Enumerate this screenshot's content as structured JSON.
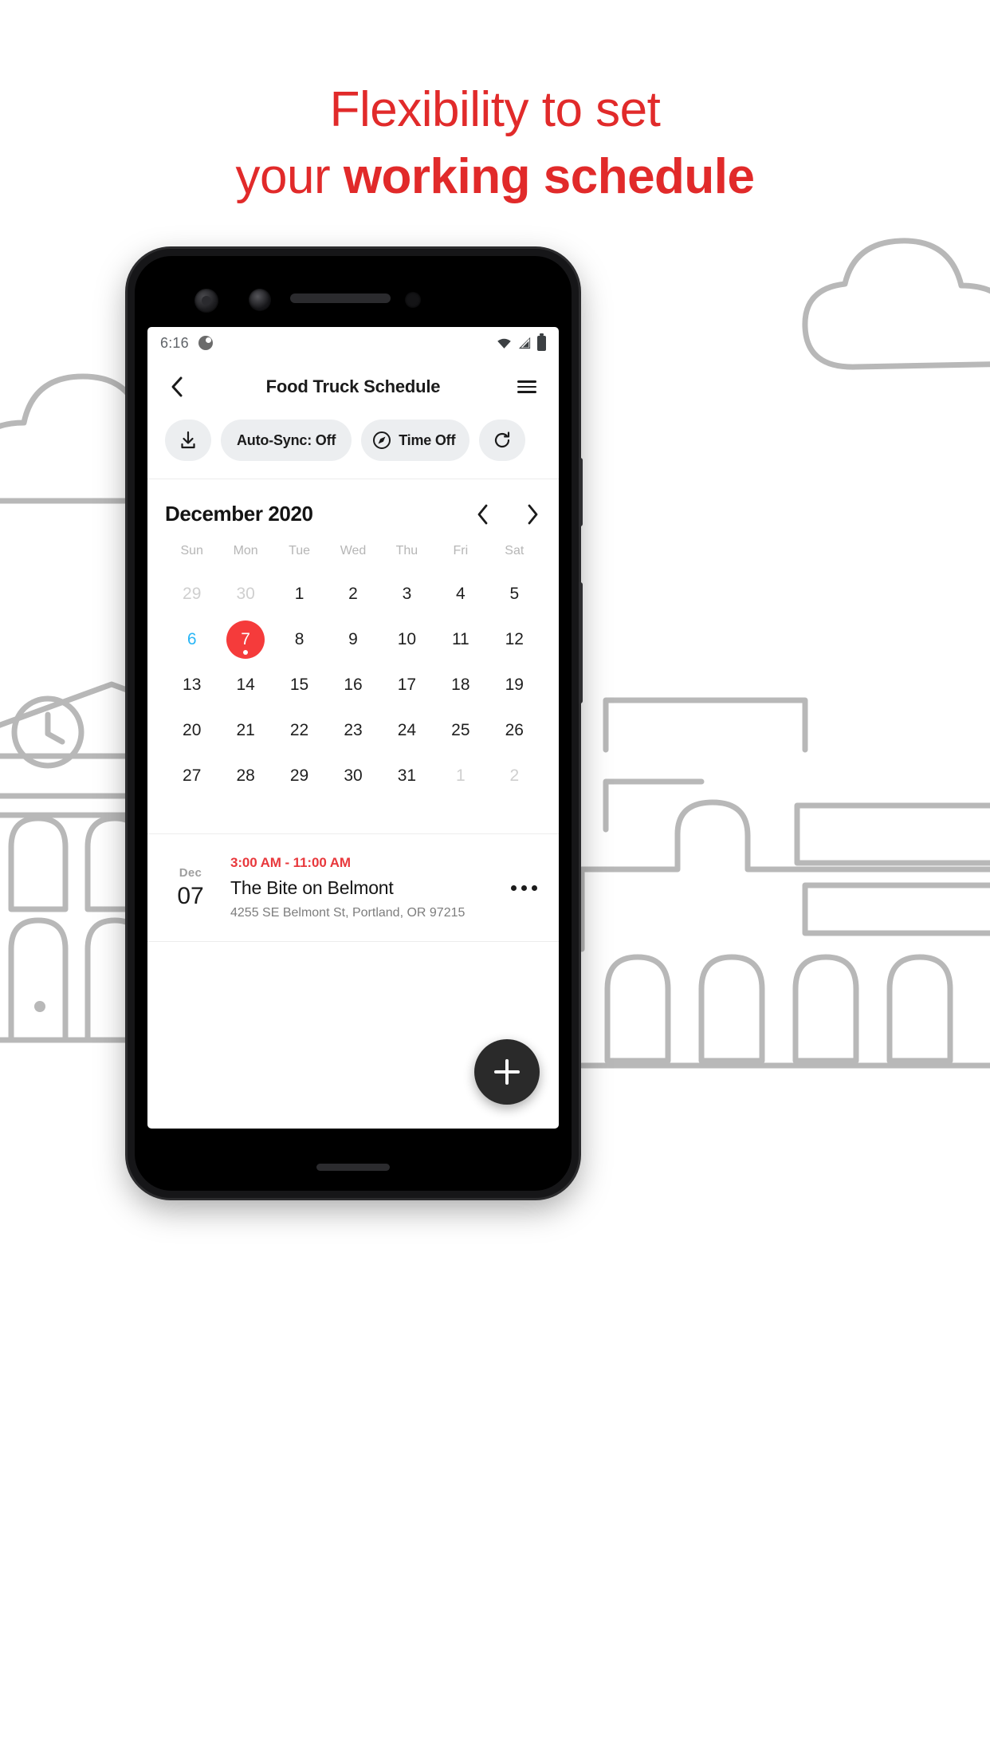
{
  "headline": {
    "line1": "Flexibility to set",
    "line2_plain": "your ",
    "line2_bold": "working schedule",
    "color": "#e12a2a"
  },
  "statusbar": {
    "time": "6:16",
    "icons": [
      "brightness-icon",
      "wifi-icon",
      "signal-icon",
      "battery-icon"
    ]
  },
  "appbar": {
    "back_icon": "chevron-left-icon",
    "title": "Food Truck Schedule",
    "menu_icon": "list-menu-icon"
  },
  "toolbar": {
    "chips": [
      {
        "id": "download",
        "label": "",
        "icon": "download-icon"
      },
      {
        "id": "auto-sync",
        "label": "Auto-Sync: Off",
        "icon": ""
      },
      {
        "id": "time-off",
        "label": "Time Off",
        "icon": "compass-icon"
      },
      {
        "id": "refresh",
        "label": "",
        "icon": "refresh-icon"
      }
    ]
  },
  "calendar": {
    "title": "December 2020",
    "prev_icon": "chevron-left-icon",
    "next_icon": "chevron-right-icon",
    "weekdays": [
      "Sun",
      "Mon",
      "Tue",
      "Wed",
      "Thu",
      "Fri",
      "Sat"
    ],
    "selected_color": "#f53b3b",
    "today_color": "#29b6f6",
    "weeks": [
      [
        {
          "d": "29",
          "state": "muted"
        },
        {
          "d": "30",
          "state": "muted"
        },
        {
          "d": "1",
          "state": "normal"
        },
        {
          "d": "2",
          "state": "normal"
        },
        {
          "d": "3",
          "state": "normal"
        },
        {
          "d": "4",
          "state": "normal"
        },
        {
          "d": "5",
          "state": "normal"
        }
      ],
      [
        {
          "d": "6",
          "state": "today"
        },
        {
          "d": "7",
          "state": "selected"
        },
        {
          "d": "8",
          "state": "normal"
        },
        {
          "d": "9",
          "state": "normal"
        },
        {
          "d": "10",
          "state": "normal"
        },
        {
          "d": "11",
          "state": "normal"
        },
        {
          "d": "12",
          "state": "normal"
        }
      ],
      [
        {
          "d": "13",
          "state": "normal"
        },
        {
          "d": "14",
          "state": "normal"
        },
        {
          "d": "15",
          "state": "normal"
        },
        {
          "d": "16",
          "state": "normal"
        },
        {
          "d": "17",
          "state": "normal"
        },
        {
          "d": "18",
          "state": "normal"
        },
        {
          "d": "19",
          "state": "normal"
        }
      ],
      [
        {
          "d": "20",
          "state": "normal"
        },
        {
          "d": "21",
          "state": "normal"
        },
        {
          "d": "22",
          "state": "normal"
        },
        {
          "d": "23",
          "state": "normal"
        },
        {
          "d": "24",
          "state": "normal"
        },
        {
          "d": "25",
          "state": "normal"
        },
        {
          "d": "26",
          "state": "normal"
        }
      ],
      [
        {
          "d": "27",
          "state": "normal"
        },
        {
          "d": "28",
          "state": "normal"
        },
        {
          "d": "29",
          "state": "normal"
        },
        {
          "d": "30",
          "state": "normal"
        },
        {
          "d": "31",
          "state": "normal"
        },
        {
          "d": "1",
          "state": "muted"
        },
        {
          "d": "2",
          "state": "muted"
        }
      ]
    ]
  },
  "events": [
    {
      "month": "Dec",
      "day": "07",
      "time": "3:00 AM - 11:00 AM",
      "time_color": "#e8383c",
      "name": "The Bite on Belmont",
      "address": "4255 SE Belmont St, Portland, OR 97215",
      "more_icon": "more-horizontal-icon"
    }
  ],
  "fab": {
    "icon": "plus-icon",
    "label": ""
  }
}
